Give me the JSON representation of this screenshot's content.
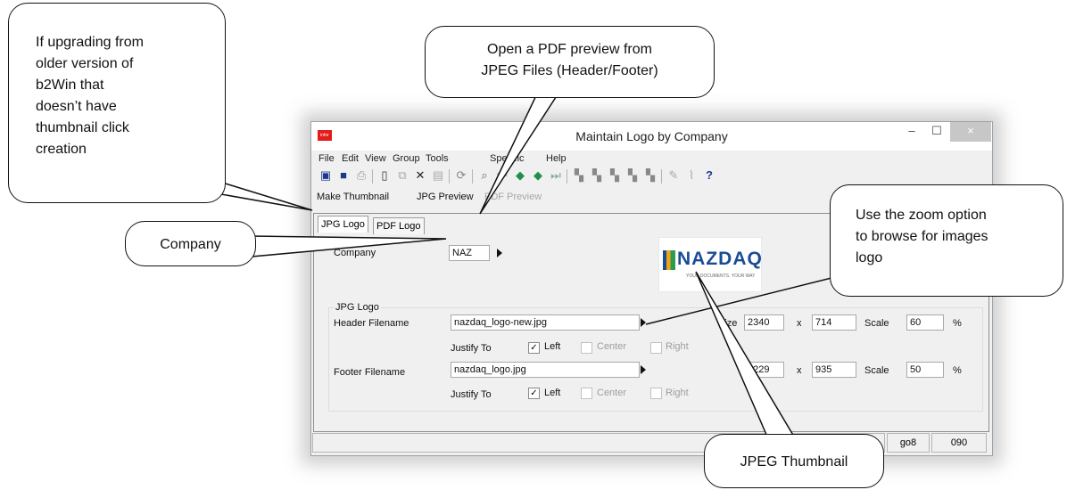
{
  "window": {
    "title": "Maintain Logo by Company",
    "app_icon_label": "infor",
    "minimize": "–",
    "maximize": "☐",
    "close": "×"
  },
  "menu": [
    "File",
    "Edit",
    "View",
    "Group",
    "Tools",
    "Specific",
    "Help"
  ],
  "toolbar_icons": [
    "save-close-icon",
    "save-icon",
    "print-icon",
    "new-icon",
    "copy-icon",
    "delete-icon",
    "paste-icon",
    "refresh-icon",
    "find-icon",
    "first-icon",
    "prev-icon",
    "next-icon",
    "last-icon",
    "tool1-icon",
    "tool2-icon",
    "tool3-icon",
    "tool4-icon",
    "tool5-icon",
    "tool6-icon",
    "attach-icon",
    "help-icon"
  ],
  "actions": {
    "make_thumbnail": "Make Thumbnail",
    "jpg_preview": "JPG Preview",
    "pdf_preview": "PDF Preview"
  },
  "tabs": [
    "JPG Logo",
    "PDF Logo"
  ],
  "form": {
    "company_label": "Company",
    "company_value": "NAZ",
    "group_label": "JPG Logo",
    "header_label": "Header Filename",
    "header_value": "nazdaq_logo-new.jpg",
    "footer_label": "Footer Filename",
    "footer_value": "nazdaq_logo.jpg",
    "justify_label": "Justify To",
    "left": "Left",
    "center": "Center",
    "right": "Right",
    "size_label": "Size",
    "x_label": "x",
    "scale_label": "Scale",
    "percent": "%",
    "header_width": "2340",
    "header_height": "714",
    "header_scale": "60",
    "footer_width": "3229",
    "footer_height": "935",
    "footer_scale": "50"
  },
  "logo": {
    "text": "NAZDAQ",
    "tagline": "YOUR DOCUMENTS. YOUR WAY"
  },
  "status": {
    "field1": "go8",
    "field2": "090"
  },
  "callouts": {
    "upgrade": [
      "If upgrading from",
      "older version of",
      "b2Win that",
      "doesn’t have",
      "thumbnail click",
      "creation"
    ],
    "pdf_preview": [
      "Open a PDF preview from",
      "JPEG Files (Header/Footer)"
    ],
    "company": "Company",
    "zoom": [
      "Use the zoom option",
      "to browse for images",
      "logo"
    ],
    "thumbnail": "JPEG Thumbnail"
  },
  "colors": {
    "accent_red": "#e21b1b",
    "logo_blue": "#1a4c96"
  }
}
